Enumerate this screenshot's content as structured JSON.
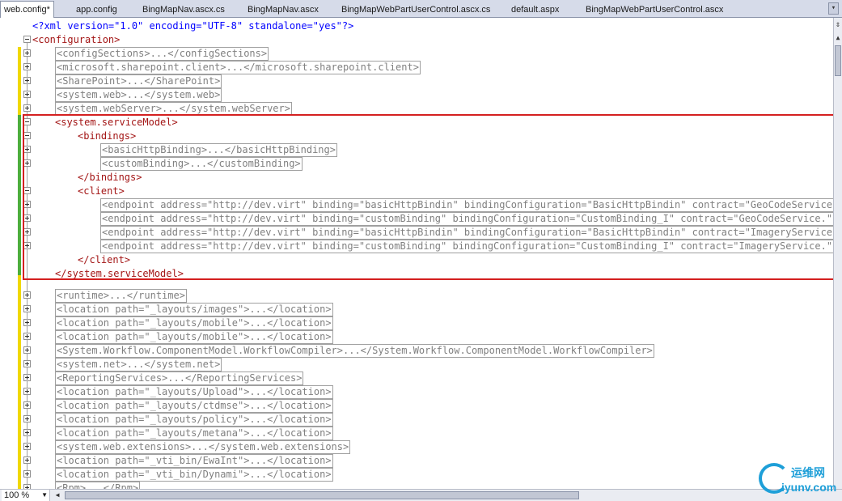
{
  "tabs": [
    {
      "label": "web.config*",
      "active": true
    },
    {
      "label": "app.config",
      "active": false
    },
    {
      "label": "BingMapNav.ascx.cs",
      "active": false
    },
    {
      "label": "BingMapNav.ascx",
      "active": false
    },
    {
      "label": "BingMapWebPartUserControl.ascx.cs",
      "active": false
    },
    {
      "label": "default.aspx",
      "active": false
    },
    {
      "label": "BingMapWebPartUserControl.ascx",
      "active": false
    }
  ],
  "editor": {
    "xml_decl": "<?xml version=\"1.0\" encoding=\"UTF-8\" standalone=\"yes\"?>",
    "root_open": "<configuration>",
    "collapsed_top": [
      "<configSections>...</configSections>",
      "<microsoft.sharepoint.client>...</microsoft.sharepoint.client>",
      "<SharePoint>...</SharePoint>",
      "<system.web>...</system.web>",
      "<system.webServer>...</system.webServer>"
    ],
    "service_model_open": "<system.serviceModel>",
    "bindings_open": "<bindings>",
    "binding_items": [
      "<basicHttpBinding>...</basicHttpBinding>",
      "<customBinding>...</customBinding>"
    ],
    "bindings_close": "</bindings>",
    "client_open": "<client>",
    "endpoints": [
      "<endpoint address=\"http://dev.virt\" binding=\"basicHttpBindin\" bindingConfiguration=\"BasicHttpBindin\" contract=\"GeoCodeService.\" na",
      "<endpoint address=\"http://dev.virt\" binding=\"customBinding\" bindingConfiguration=\"CustomBinding_I\" contract=\"GeoCodeService.\" name",
      "<endpoint address=\"http://dev.virt\" binding=\"basicHttpBindin\" bindingConfiguration=\"BasicHttpBindin\" contract=\"ImageryService.\" na",
      "<endpoint address=\"http://dev.virt\" binding=\"customBinding\" bindingConfiguration=\"CustomBinding_I\" contract=\"ImageryService.\" name"
    ],
    "client_close": "</client>",
    "service_model_close": "</system.serviceModel>",
    "collapsed_bottom": [
      "<runtime>...</runtime>",
      "<location path=\"_layouts/images\">...</location>",
      "<location path=\"_layouts/mobile\">...</location>",
      "<location path=\"_layouts/mobile\">...</location>",
      "<System.Workflow.ComponentModel.WorkflowCompiler>...</System.Workflow.ComponentModel.WorkflowCompiler>",
      "<system.net>...</system.net>",
      "<ReportingServices>...</ReportingServices>",
      "<location path=\"_layouts/Upload\">...</location>",
      "<location path=\"_layouts/ctdmse\">...</location>",
      "<location path=\"_layouts/policy\">...</location>",
      "<location path=\"_layouts/metana\">...</location>",
      "<system.web.extensions>...</system.web.extensions>",
      "<location path=\"_vti_bin/EwaInt\">...</location>",
      "<location path=\"_vti_bin/Dynami\">...</location>",
      "<Rpm>...</Rpm>"
    ]
  },
  "zoom": "100 %",
  "watermark": {
    "cn": "运维网",
    "en": "iyunv.com"
  },
  "colors": {
    "tag": "#a31515",
    "attr": "#ff0000",
    "value": "#0000ff",
    "highlight": "#d42020"
  }
}
